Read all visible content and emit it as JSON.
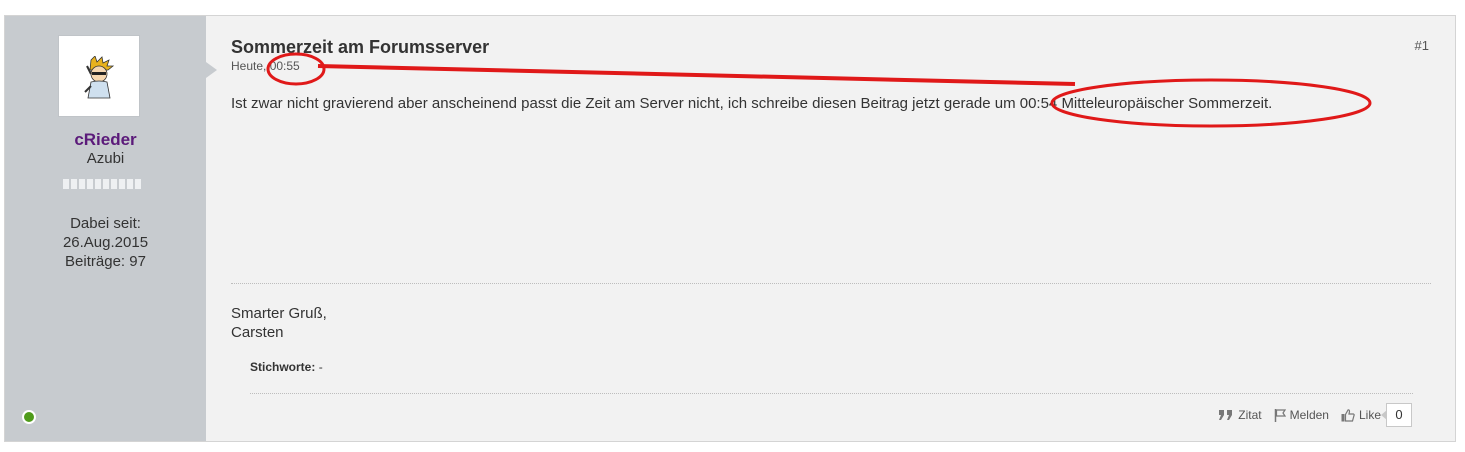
{
  "author": {
    "username": "cRieder",
    "rank": "Azubi",
    "joined_label": "Dabei seit:",
    "joined_date": "26.Aug.2015",
    "posts": "Beiträge: 97",
    "avatar_icon": "cartoon-avatar-icon",
    "online_status": "online"
  },
  "post": {
    "title": "Sommerzeit am Forumsserver",
    "date": "Heute, 00:55",
    "number": "#1",
    "message": "Ist zwar nicht gravierend aber anscheinend passt die Zeit am Server nicht, ich schreibe diesen Beitrag jetzt gerade um 00:54 Mitteleuropäischer Sommerzeit.",
    "signature_line1": "Smarter Gruß,",
    "signature_line2": "Carsten",
    "tags_label": "Stichworte:",
    "tags_value": "-"
  },
  "actions": {
    "quote": "Zitat",
    "report": "Melden",
    "like": "Like",
    "like_count": "0"
  },
  "colors": {
    "username": "#5b1a7a",
    "sidebar": "#c7cbcf",
    "annotation": "#e01919",
    "online": "#4f9b1b"
  }
}
